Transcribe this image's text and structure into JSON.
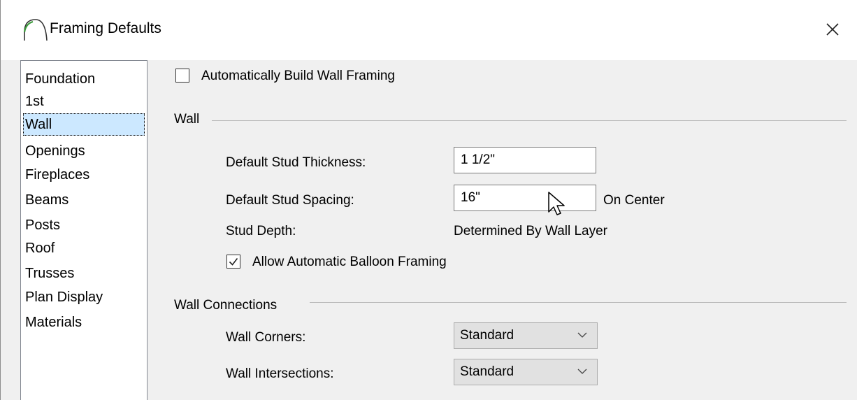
{
  "window": {
    "title": "Framing Defaults"
  },
  "sidebar": {
    "selected": "Wall",
    "items": [
      "Foundation",
      "1st",
      "Wall",
      "Openings",
      "Fireplaces",
      "Beams",
      "Posts",
      "Roof",
      "Trusses",
      "Plan Display",
      "Materials"
    ]
  },
  "auto_build": {
    "label": "Automatically Build Wall Framing",
    "checked": false
  },
  "wall_group": {
    "title": "Wall",
    "stud_thickness": {
      "label": "Default Stud Thickness:",
      "value": "1 1/2\""
    },
    "stud_spacing": {
      "label": "Default Stud Spacing:",
      "value": "16\"",
      "suffix": "On Center"
    },
    "stud_depth": {
      "label": "Stud Depth:",
      "value": "Determined By Wall Layer"
    },
    "balloon_framing": {
      "label": "Allow Automatic Balloon Framing",
      "checked": true
    }
  },
  "connections_group": {
    "title": "Wall Connections",
    "corners": {
      "label": "Wall Corners:",
      "value": "Standard"
    },
    "intersections": {
      "label": "Wall Intersections:",
      "value": "Standard"
    }
  },
  "icons": {
    "app": "arch-icon",
    "close": "close-icon",
    "dropdown": "chevron-down-icon",
    "check": "checkmark-icon",
    "cursor": "mouse-pointer-icon"
  },
  "colors": {
    "selection": "#cce8ff",
    "window_bg": "#f0f0f0",
    "titlebar_bg": "#ffffff"
  }
}
